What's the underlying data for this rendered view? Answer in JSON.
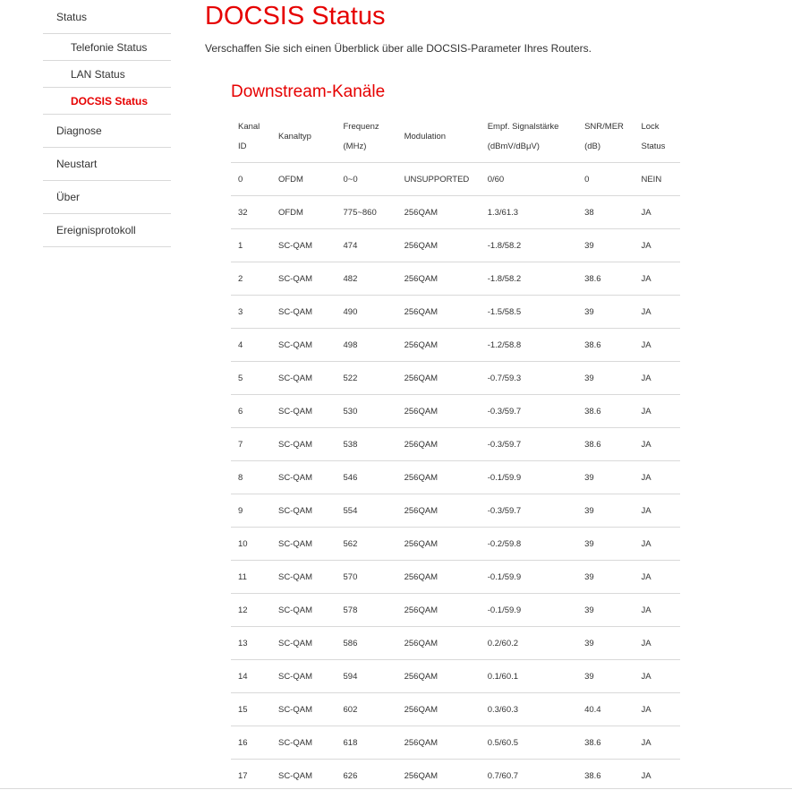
{
  "sidebar": {
    "status": "Status",
    "sub_items": [
      {
        "label": "Telefonie Status",
        "active": false
      },
      {
        "label": "LAN Status",
        "active": false
      },
      {
        "label": "DOCSIS Status",
        "active": true
      }
    ],
    "main_items": [
      "Diagnose",
      "Neustart",
      "Über",
      "Ereignisprotokoll"
    ]
  },
  "main": {
    "title": "DOCSIS Status",
    "description": "Verschaffen Sie sich einen Überblick über alle DOCSIS-Parameter Ihres Routers.",
    "section_title": "Downstream-Kanäle"
  },
  "table": {
    "headers": [
      [
        "Kanal",
        "ID"
      ],
      [
        "Kanaltyp"
      ],
      [
        "Frequenz",
        "(MHz)"
      ],
      [
        "Modulation"
      ],
      [
        "Empf. Signalstärke",
        "(dBmV/dBμV)"
      ],
      [
        "SNR/MER",
        "(dB)"
      ],
      [
        "Lock",
        "Status"
      ]
    ],
    "rows": [
      [
        "0",
        "OFDM",
        "0~0",
        "UNSUPPORTED",
        "0/60",
        "0",
        "NEIN"
      ],
      [
        "32",
        "OFDM",
        "775~860",
        "256QAM",
        "1.3/61.3",
        "38",
        "JA"
      ],
      [
        "1",
        "SC-QAM",
        "474",
        "256QAM",
        "-1.8/58.2",
        "39",
        "JA"
      ],
      [
        "2",
        "SC-QAM",
        "482",
        "256QAM",
        "-1.8/58.2",
        "38.6",
        "JA"
      ],
      [
        "3",
        "SC-QAM",
        "490",
        "256QAM",
        "-1.5/58.5",
        "39",
        "JA"
      ],
      [
        "4",
        "SC-QAM",
        "498",
        "256QAM",
        "-1.2/58.8",
        "38.6",
        "JA"
      ],
      [
        "5",
        "SC-QAM",
        "522",
        "256QAM",
        "-0.7/59.3",
        "39",
        "JA"
      ],
      [
        "6",
        "SC-QAM",
        "530",
        "256QAM",
        "-0.3/59.7",
        "38.6",
        "JA"
      ],
      [
        "7",
        "SC-QAM",
        "538",
        "256QAM",
        "-0.3/59.7",
        "38.6",
        "JA"
      ],
      [
        "8",
        "SC-QAM",
        "546",
        "256QAM",
        "-0.1/59.9",
        "39",
        "JA"
      ],
      [
        "9",
        "SC-QAM",
        "554",
        "256QAM",
        "-0.3/59.7",
        "39",
        "JA"
      ],
      [
        "10",
        "SC-QAM",
        "562",
        "256QAM",
        "-0.2/59.8",
        "39",
        "JA"
      ],
      [
        "11",
        "SC-QAM",
        "570",
        "256QAM",
        "-0.1/59.9",
        "39",
        "JA"
      ],
      [
        "12",
        "SC-QAM",
        "578",
        "256QAM",
        "-0.1/59.9",
        "39",
        "JA"
      ],
      [
        "13",
        "SC-QAM",
        "586",
        "256QAM",
        "0.2/60.2",
        "39",
        "JA"
      ],
      [
        "14",
        "SC-QAM",
        "594",
        "256QAM",
        "0.1/60.1",
        "39",
        "JA"
      ],
      [
        "15",
        "SC-QAM",
        "602",
        "256QAM",
        "0.3/60.3",
        "40.4",
        "JA"
      ],
      [
        "16",
        "SC-QAM",
        "618",
        "256QAM",
        "0.5/60.5",
        "38.6",
        "JA"
      ],
      [
        "17",
        "SC-QAM",
        "626",
        "256QAM",
        "0.7/60.7",
        "38.6",
        "JA"
      ]
    ]
  },
  "colors": {
    "accent": "#e60000",
    "text": "#333333",
    "divider": "#d9d9d9"
  }
}
